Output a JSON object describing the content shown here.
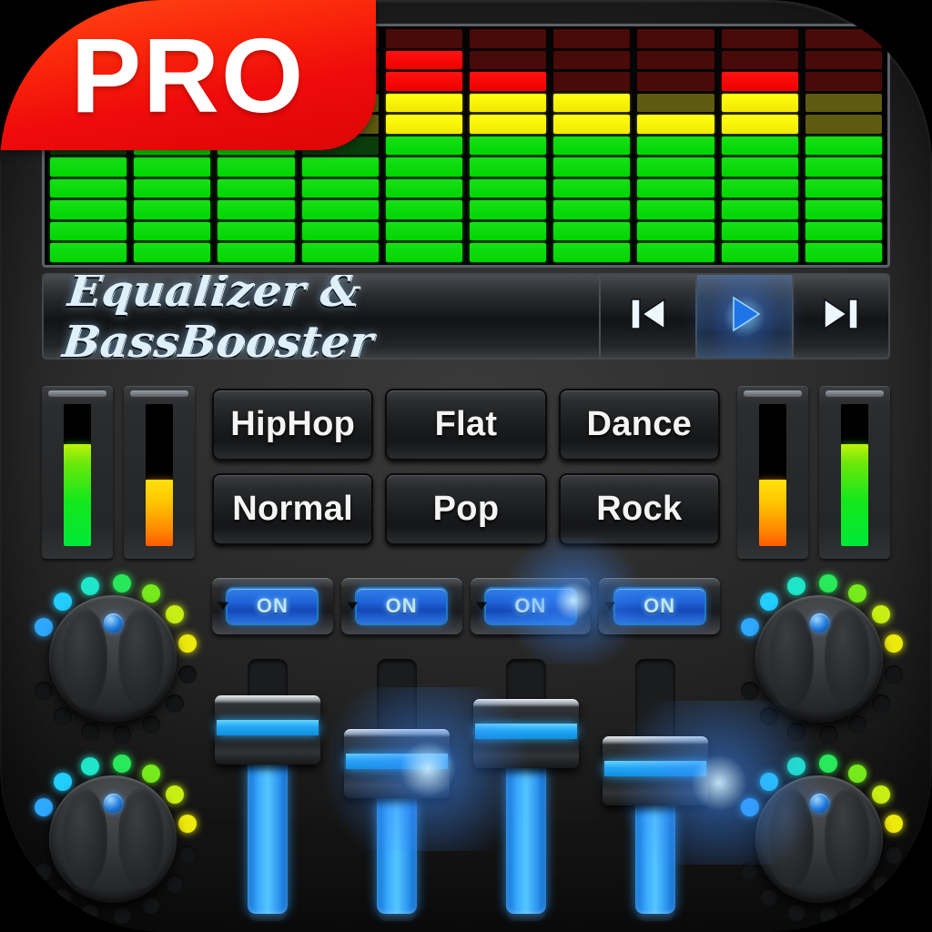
{
  "app": {
    "title": "Equalizer & BassBooster",
    "badge_label": "PRO",
    "badge_color": "#ef0b0b",
    "accent_color": "#22a8f5",
    "chassis_color": "#2e2e2e"
  },
  "spectrum": {
    "columns": 10,
    "rows": 11,
    "row_colors": [
      "red",
      "red",
      "red",
      "yellow",
      "yellow",
      "green",
      "green",
      "green",
      "green",
      "green",
      "green"
    ],
    "levels": [
      5,
      6,
      6,
      5,
      10,
      9,
      8,
      7,
      9,
      6
    ]
  },
  "transport": {
    "prev_label": "previous-track",
    "play_label": "play",
    "next_label": "next-track",
    "play_active": true
  },
  "meters": {
    "left": [
      {
        "name": "meter-l1",
        "value": 72,
        "color": "green"
      },
      {
        "name": "meter-l2",
        "value": 47,
        "color": "orange"
      }
    ],
    "right": [
      {
        "name": "meter-r1",
        "value": 47,
        "color": "orange"
      },
      {
        "name": "meter-r2",
        "value": 72,
        "color": "green"
      }
    ]
  },
  "presets": [
    {
      "id": "hiphop",
      "label": "HipHop"
    },
    {
      "id": "flat",
      "label": "Flat"
    },
    {
      "id": "dance",
      "label": "Dance"
    },
    {
      "id": "normal",
      "label": "Normal"
    },
    {
      "id": "pop",
      "label": "Pop"
    },
    {
      "id": "rock",
      "label": "Rock"
    }
  ],
  "toggles": [
    {
      "id": "toggle-1",
      "label": "ON",
      "state": "on"
    },
    {
      "id": "toggle-2",
      "label": "ON",
      "state": "on"
    },
    {
      "id": "toggle-3",
      "label": "ON",
      "state": "on"
    },
    {
      "id": "toggle-4",
      "label": "ON",
      "state": "on"
    }
  ],
  "knobs": [
    {
      "id": "knob-top-left",
      "value": 50,
      "leds_lit": 7,
      "leds_total": 14
    },
    {
      "id": "knob-top-right",
      "value": 50,
      "leds_lit": 7,
      "leds_total": 14
    },
    {
      "id": "knob-bottom-left",
      "value": 50,
      "leds_lit": 7,
      "leds_total": 14
    },
    {
      "id": "knob-bottom-right",
      "value": 50,
      "leds_lit": 7,
      "leds_total": 14
    }
  ],
  "sliders": [
    {
      "id": "band-1",
      "value": 78
    },
    {
      "id": "band-2",
      "value": 60
    },
    {
      "id": "band-3",
      "value": 76
    },
    {
      "id": "band-4",
      "value": 56
    }
  ]
}
